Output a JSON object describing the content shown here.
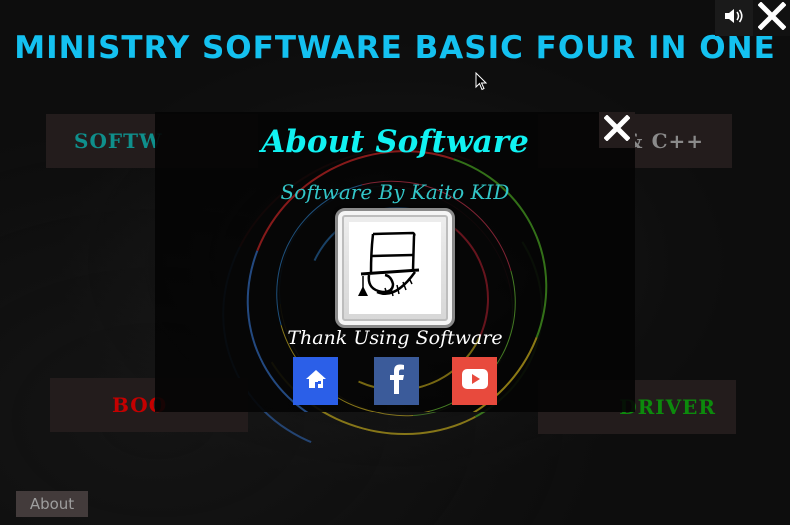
{
  "window": {
    "title": "MINISTRY SOFTWARE BASIC FOUR IN ONE",
    "controls": [
      {
        "name": "sound",
        "icon": "speaker-icon"
      },
      {
        "name": "close",
        "icon": "close-icon"
      }
    ]
  },
  "menu": {
    "items": [
      {
        "label": "SOFTW",
        "color": "#0f8f8c",
        "note": "partially hidden behind modal"
      },
      {
        "label": "& C++",
        "color": "#8a8a8a",
        "note": "partially hidden behind modal"
      },
      {
        "label": "BOO",
        "color": "#c40000",
        "note": "partially hidden behind modal"
      },
      {
        "label": "DRIVER",
        "color": "#0c8a0c",
        "note": "partially hidden behind modal"
      }
    ]
  },
  "footer": {
    "about_label": "About"
  },
  "modal": {
    "title": "About Software",
    "subtitle": "Software By Kaito KID",
    "logo": "kaito-kid-top-hat-logo",
    "thanks": "Thank Using Software",
    "close_icon": "close-icon",
    "social": [
      {
        "name": "home",
        "icon": "home-icon",
        "color": "#2b5fe8"
      },
      {
        "name": "facebook",
        "icon": "facebook-icon",
        "color": "#3b5b9a"
      },
      {
        "name": "youtube",
        "icon": "youtube-icon",
        "color": "#e84a3d"
      }
    ]
  },
  "colors": {
    "title": "#14c1f0",
    "modal_title": "#11f2f2",
    "modal_subtitle": "#33c6c8",
    "box_bg": "#231c1c",
    "about_bg": "#433b3b"
  }
}
